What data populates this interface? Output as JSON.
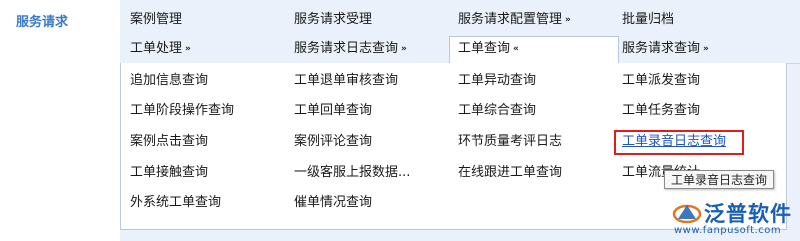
{
  "sidebar": {
    "title": "服务请求"
  },
  "top_menu": {
    "row1": [
      {
        "label": "案例管理",
        "chevron": false
      },
      {
        "label": "服务请求受理",
        "chevron": false
      },
      {
        "label": "服务请求配置管理",
        "chevron": true,
        "chevron_dir": "down"
      },
      {
        "label": "批量归档",
        "chevron": false
      }
    ],
    "row2": [
      {
        "label": "工单处理",
        "chevron": true,
        "chevron_dir": "down"
      },
      {
        "label": "服务请求日志查询",
        "chevron": true,
        "chevron_dir": "down"
      },
      {
        "label": "工单查询",
        "chevron": true,
        "chevron_dir": "up",
        "active": true
      },
      {
        "label": "服务请求查询",
        "chevron": true,
        "chevron_dir": "down"
      }
    ]
  },
  "chevrons": {
    "down": "»",
    "up": "«"
  },
  "dropdown": {
    "rows": [
      [
        "追加信息查询",
        "工单退单审核查询",
        "工单异动查询",
        "工单派发查询"
      ],
      [
        "工单阶段操作查询",
        "工单回单查询",
        "工单综合查询",
        "工单任务查询"
      ],
      [
        "案例点击查询",
        "案例评论查询",
        "环节质量考评日志",
        "工单录音日志查询"
      ],
      [
        "工单接触查询",
        "一级客服上报数据...",
        "在线跟进工单查询",
        "工单流量统计"
      ],
      [
        "外系统工单查询",
        "催单情况查询",
        "",
        ""
      ]
    ],
    "highlighted": "工单录音日志查询"
  },
  "tooltip": {
    "text": "工单录音日志查询"
  },
  "watermark": {
    "brand": "泛普软件",
    "url": "www.fanpusoft.com"
  },
  "colors": {
    "accent": "#3a7bc8",
    "highlight_border": "#e21b1b",
    "link": "#1f55c4",
    "panel_bg": "#eaf1fa"
  }
}
